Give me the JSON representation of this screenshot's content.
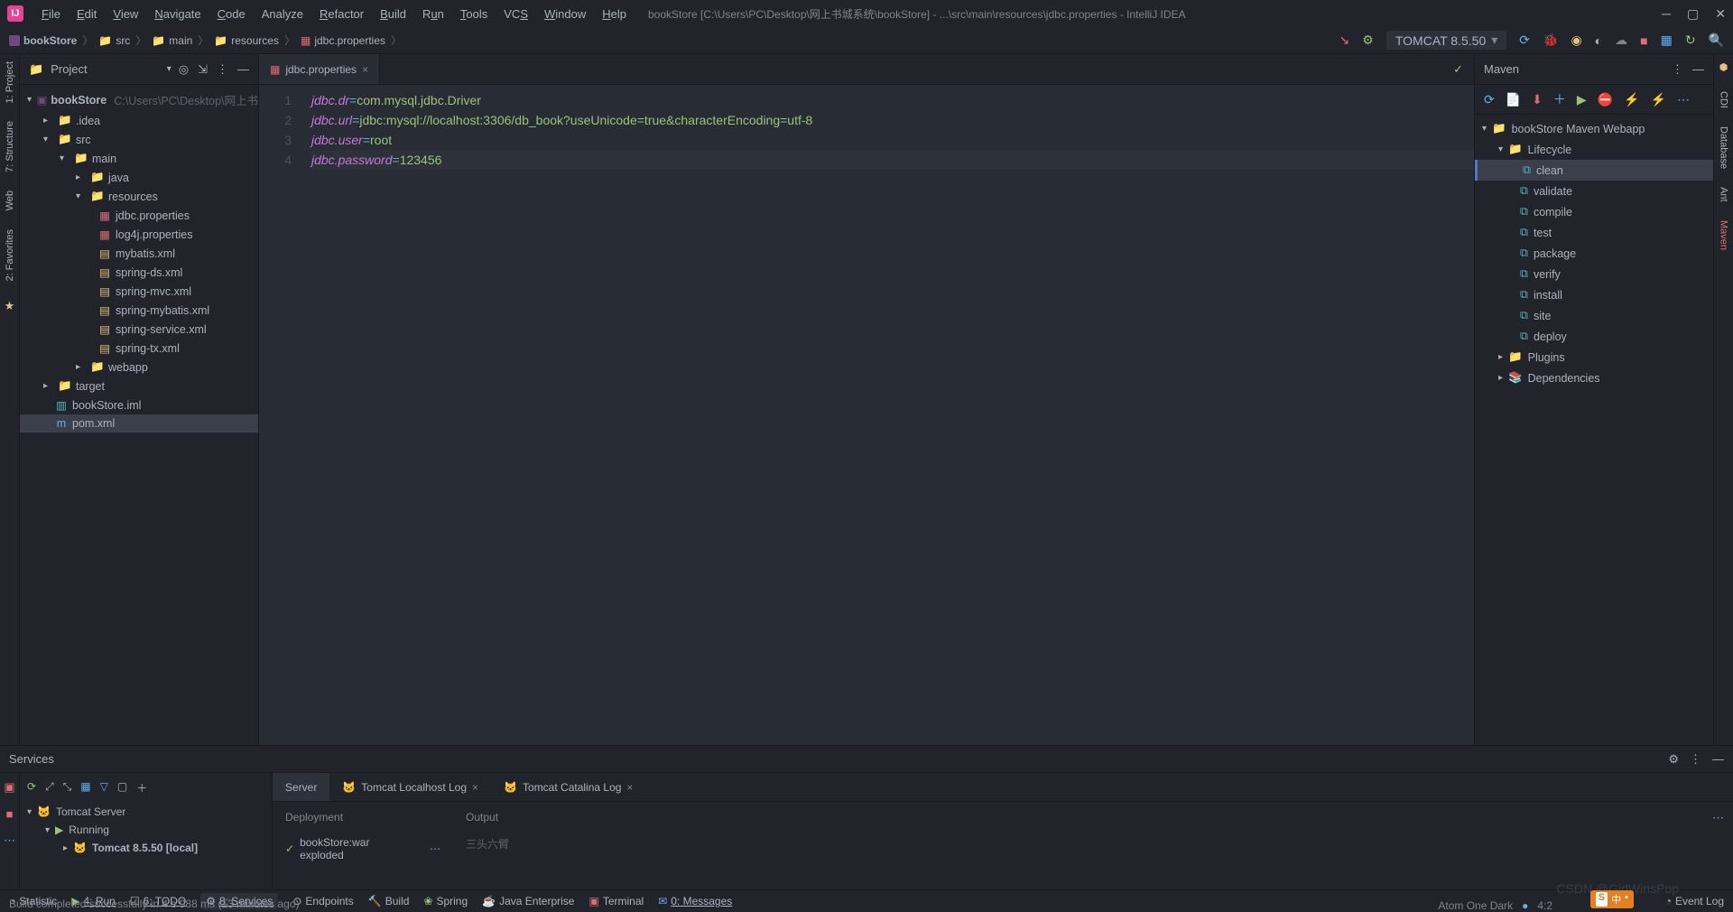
{
  "menu": {
    "file": "File",
    "edit": "Edit",
    "view": "View",
    "navigate": "Navigate",
    "code": "Code",
    "analyze": "Analyze",
    "refactor": "Refactor",
    "build": "Build",
    "run": "Run",
    "tools": "Tools",
    "vcs": "VCS",
    "window": "Window",
    "help": "Help"
  },
  "window_title": "bookStore [C:\\Users\\PC\\Desktop\\网上书城系统\\bookStore] - ...\\src\\main\\resources\\jdbc.properties - IntelliJ IDEA",
  "breadcrumb": [
    "bookStore",
    "src",
    "main",
    "resources",
    "jdbc.properties"
  ],
  "run_config": "TOMCAT 8.5.50",
  "left_tabs": {
    "project": "1: Project",
    "structure": "7: Structure",
    "web": "Web",
    "favorites": "2: Favorites"
  },
  "right_tabs": {
    "cdi": "CDI",
    "database": "Database",
    "ant": "Ant",
    "maven": "Maven"
  },
  "project_panel": {
    "title": "Project"
  },
  "tree": {
    "root": {
      "name": "bookStore",
      "path": "C:\\Users\\PC\\Desktop\\网上书"
    },
    "idea": ".idea",
    "src": "src",
    "main_f": "main",
    "java": "java",
    "resources": "resources",
    "files": {
      "jdbc": "jdbc.properties",
      "log4j": "log4j.properties",
      "mybatis": "mybatis.xml",
      "springds": "spring-ds.xml",
      "springmvc": "spring-mvc.xml",
      "springmybatis": "spring-mybatis.xml",
      "springservice": "spring-service.xml",
      "springtx": "spring-tx.xml"
    },
    "webapp": "webapp",
    "target": "target",
    "iml": "bookStore.iml",
    "pom": "pom.xml"
  },
  "editor": {
    "tab": "jdbc.properties",
    "lines": {
      "l1k": "jdbc.dr",
      "l1v": "com.mysql.jdbc.Driver",
      "l2k": "jdbc.url",
      "l2v": "jdbc:mysql://localhost:3306/db_book?useUnicode=true&characterEncoding=utf-8",
      "l3k": "jdbc.user",
      "l3v": "root",
      "l4k": "jdbc.password",
      "l4v": "123456"
    }
  },
  "maven": {
    "title": "Maven",
    "root": "bookStore Maven Webapp",
    "lifecycle": "Lifecycle",
    "phases": {
      "clean": "clean",
      "validate": "validate",
      "compile": "compile",
      "test": "test",
      "package": "package",
      "verify": "verify",
      "install": "install",
      "site": "site",
      "deploy": "deploy"
    },
    "plugins": "Plugins",
    "deps": "Dependencies"
  },
  "services": {
    "title": "Services",
    "tabs": {
      "server": "Server",
      "localhost": "Tomcat Localhost Log",
      "catalina": "Tomcat Catalina Log"
    },
    "tree": {
      "tomcat": "Tomcat Server",
      "running": "Running",
      "instance": "Tomcat 8.5.50 [local]"
    },
    "deploy_title": "Deployment",
    "output_title": "Output",
    "deploy_item": "bookStore:war exploded",
    "output_text": "三头六臂"
  },
  "bottom": {
    "statistic": "Statistic",
    "run": "4: Run",
    "todo": "6: TODO",
    "services": "8: Services",
    "endpoints": "Endpoints",
    "build": "Build",
    "spring": "Spring",
    "je": "Java Enterprise",
    "terminal": "Terminal",
    "messages": "0: Messages",
    "eventlog": "Event Log"
  },
  "status_msg": "Build completed successfully in 4 s 988 ms (13 minutes ago)",
  "status_right": {
    "theme": "Atom One Dark",
    "pos": "4:2"
  },
  "watermark": "CSDN @GirlWinsPop",
  "ime": {
    "zhong": "中",
    "dot": "•"
  }
}
